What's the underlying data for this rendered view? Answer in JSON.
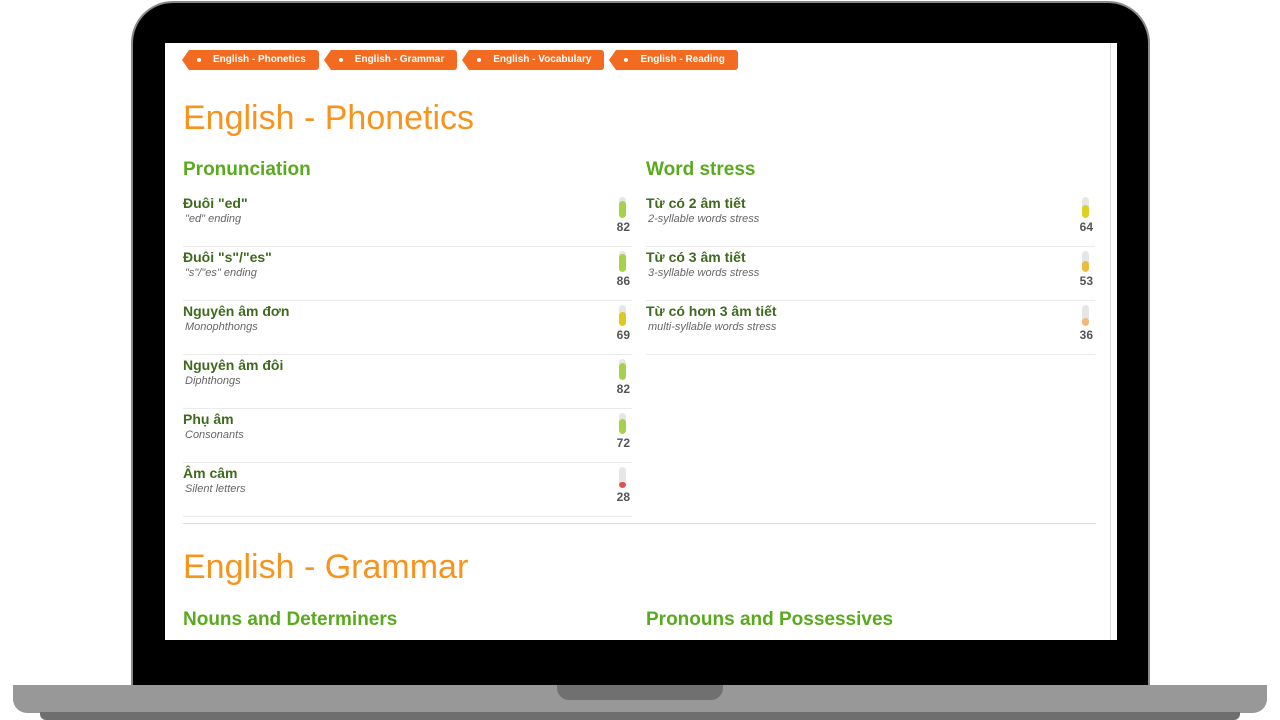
{
  "tags": [
    "English - Phonetics",
    "English - Grammar",
    "English - Vocabulary",
    "English - Reading"
  ],
  "sections": [
    {
      "title": "English - Phonetics",
      "groups": [
        {
          "title": "Pronunciation",
          "items": [
            {
              "name": "Đuôi \"ed\"",
              "sub": "\"ed\" ending",
              "score": "82",
              "color": "#a5d24a"
            },
            {
              "name": "Đuôi \"s\"/\"es\"",
              "sub": "\"s\"/\"es\" ending",
              "score": "86",
              "color": "#a5d24a"
            },
            {
              "name": "Nguyên âm đơn",
              "sub": "Monophthongs",
              "score": "69",
              "color": "#e0c81e"
            },
            {
              "name": "Nguyên âm đôi",
              "sub": "Diphthongs",
              "score": "82",
              "color": "#a5d24a"
            },
            {
              "name": "Phụ âm",
              "sub": "Consonants",
              "score": "72",
              "color": "#a5d24a"
            },
            {
              "name": "Âm câm",
              "sub": "Silent letters",
              "score": "28",
              "color": "#e05050"
            }
          ]
        },
        {
          "title": "Word stress",
          "items": [
            {
              "name": "Từ có 2 âm tiết",
              "sub": "2-syllable words stress",
              "score": "64",
              "color": "#ddd020"
            },
            {
              "name": "Từ có 3 âm tiết",
              "sub": "3-syllable words stress",
              "score": "53",
              "color": "#eebc3c"
            },
            {
              "name": "Từ có hơn 3 âm tiết",
              "sub": "multi-syllable words stress",
              "score": "36",
              "color": "#f3b87a"
            }
          ]
        }
      ]
    },
    {
      "title": "English - Grammar",
      "groups": [
        {
          "title": "Nouns and Determiners"
        },
        {
          "title": "Pronouns and Possessives"
        }
      ]
    }
  ]
}
